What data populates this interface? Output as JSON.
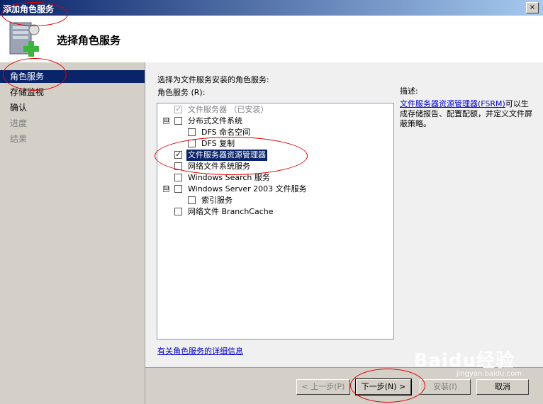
{
  "window": {
    "title": "添加角色服务",
    "close_label": "×"
  },
  "header": {
    "title": "选择角色服务"
  },
  "nav": {
    "items": [
      {
        "label": "角色服务",
        "state": "active"
      },
      {
        "label": "存储监视",
        "state": "normal"
      },
      {
        "label": "确认",
        "state": "normal"
      },
      {
        "label": "进度",
        "state": "disabled"
      },
      {
        "label": "结果",
        "state": "disabled"
      }
    ]
  },
  "main": {
    "instruction": "选择为文件服务安装的角色服务:",
    "list_label": "角色服务 (R):",
    "services": [
      {
        "label": "文件服务器  （已安装）",
        "checked": true,
        "installed": true
      },
      {
        "label": "分布式文件系统",
        "checked": false,
        "expander": "⊟"
      },
      {
        "label": "DFS 命名空间",
        "checked": false
      },
      {
        "label": "DFS 复制",
        "checked": false
      },
      {
        "label": "文件服务器资源管理器",
        "checked": true,
        "selected": true
      },
      {
        "label": "网络文件系统服务",
        "checked": false
      },
      {
        "label": "Windows Search 服务",
        "checked": false
      },
      {
        "label": "Windows Server 2003 文件服务",
        "checked": false,
        "expander": "⊟"
      },
      {
        "label": "索引服务",
        "checked": false
      },
      {
        "label": "网络文件 BranchCache",
        "checked": false
      }
    ],
    "more_info_link": "有关角色服务的详细信息",
    "description_title": "描述:",
    "description_link": "文件服务器资源管理器(FSRM)",
    "description_text": "可以生成存储报告、配置配额，并定义文件屏蔽策略。"
  },
  "footer": {
    "prev_label": "< 上一步(P)",
    "next_label": "下一步(N) >",
    "install_label": "安装(I)",
    "cancel_label": "取消"
  },
  "watermark": {
    "text": "Baidu经验",
    "subtext": "jingyan.baidu.com"
  }
}
